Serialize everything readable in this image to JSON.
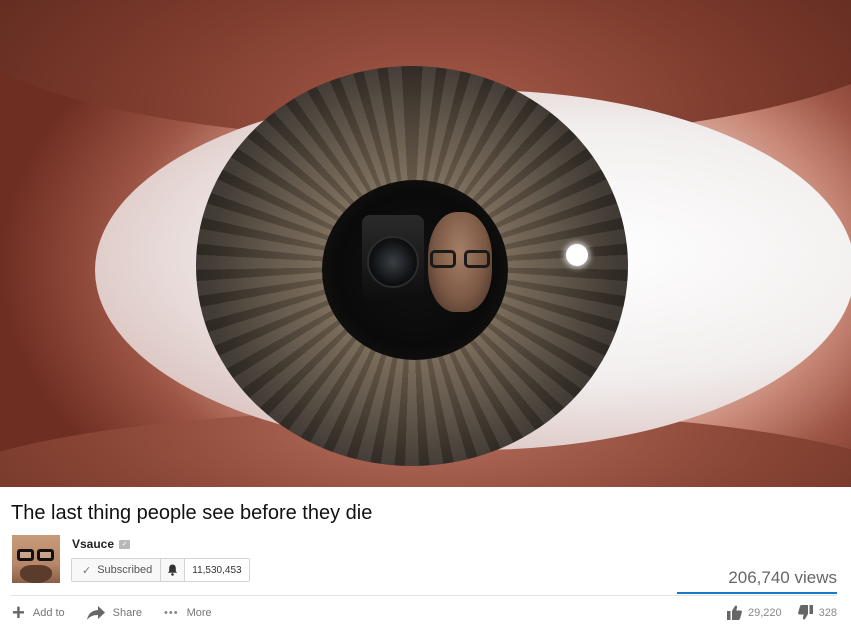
{
  "video": {
    "title": "The last thing people see before they die"
  },
  "channel": {
    "name": "Vsauce",
    "subscribe_label": "Subscribed",
    "subscriber_count": "11,530,453"
  },
  "stats": {
    "views": "206,740 views",
    "likes": "29,220",
    "dislikes": "328"
  },
  "actions": {
    "add_to": "Add to",
    "share": "Share",
    "more": "More"
  },
  "colors": {
    "views_bar": "#167ac6"
  },
  "icons": [
    "check-icon",
    "bell-icon",
    "verified-icon",
    "plus-icon",
    "share-arrow-icon",
    "more-dots-icon",
    "thumbs-up-icon",
    "thumbs-down-icon"
  ]
}
